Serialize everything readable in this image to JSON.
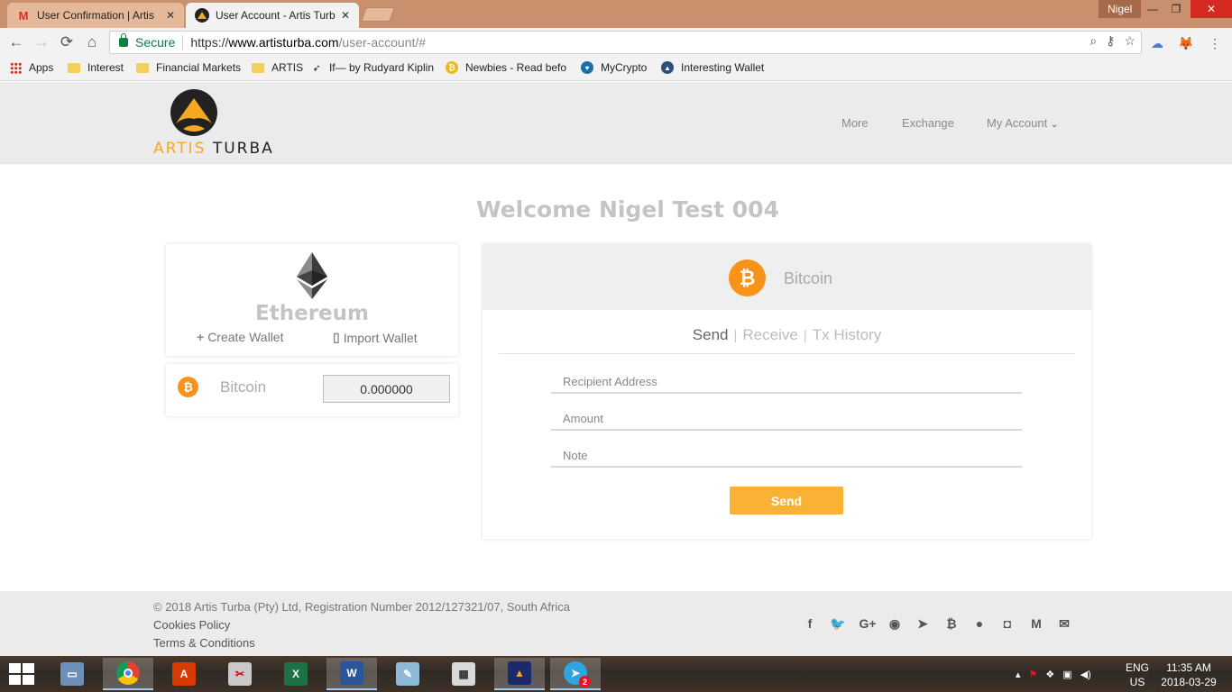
{
  "browser": {
    "tabs": [
      {
        "title": "User Confirmation | Artis",
        "favicon": "gmail-icon",
        "active": false
      },
      {
        "title": "User Account - Artis Turb",
        "favicon": "artis-turba-icon",
        "active": true
      }
    ],
    "profile": "Nigel",
    "secure_label": "Secure",
    "url_scheme": "https://",
    "url_host": "www.artisturba.com",
    "url_path": "/user-account/#",
    "bookmarks": [
      {
        "label": "Apps",
        "icon": "apps-grid-icon"
      },
      {
        "label": "Interest",
        "icon": "folder-icon"
      },
      {
        "label": "Financial Markets",
        "icon": "folder-icon"
      },
      {
        "label": "ARTIS",
        "icon": "folder-icon"
      },
      {
        "label": "If— by Rudyard Kiplin",
        "icon": "bird-icon"
      },
      {
        "label": "Newbies - Read befo",
        "icon": "bitcoin-coin-icon"
      },
      {
        "label": "MyCrypto",
        "icon": "mycrypto-icon"
      },
      {
        "label": "Interesting Wallet",
        "icon": "chart-icon"
      }
    ]
  },
  "site": {
    "logo": {
      "word1": "ARTIS",
      "word2": "TURBA"
    },
    "nav": {
      "more": "More",
      "exchange": "Exchange",
      "my_account": "My Account"
    },
    "welcome": "Welcome Nigel Test 004",
    "ethereum": {
      "name": "Ethereum",
      "create_wallet": "Create Wallet",
      "import_wallet": "Import Wallet"
    },
    "bitcoin_row": {
      "name": "Bitcoin",
      "balance": "0.000000"
    },
    "panel": {
      "coin_name": "Bitcoin",
      "tab_send": "Send",
      "tab_receive": "Receive",
      "tab_history": "Tx History",
      "recipient_placeholder": "Recipient Address",
      "amount_placeholder": "Amount",
      "note_placeholder": "Note",
      "send_button": "Send"
    },
    "footer": {
      "copyright": "© 2018 Artis Turba (Pty) Ltd, Registration Number 2012/127321/07, South Africa",
      "cookies": "Cookies Policy",
      "terms": "Terms & Conditions",
      "social": [
        "facebook-icon",
        "twitter-icon",
        "google-plus-icon",
        "github-icon",
        "telegram-icon",
        "bitcoin-icon",
        "reddit-icon",
        "instagram-icon",
        "medium-icon",
        "email-icon"
      ]
    }
  },
  "taskbar": {
    "apps": [
      "computer",
      "chrome",
      "acrobat",
      "snipping-tool",
      "excel",
      "word",
      "notepad",
      "calculator",
      "artis-turba",
      "telegram"
    ],
    "telegram_badge": "2",
    "lang_line1": "ENG",
    "lang_line2": "US",
    "time": "11:35 AM",
    "date": "2018-03-29"
  },
  "colors": {
    "accent": "#f9b233",
    "bitcoin": "#f7931a",
    "tab_bar": "#c9906e"
  }
}
